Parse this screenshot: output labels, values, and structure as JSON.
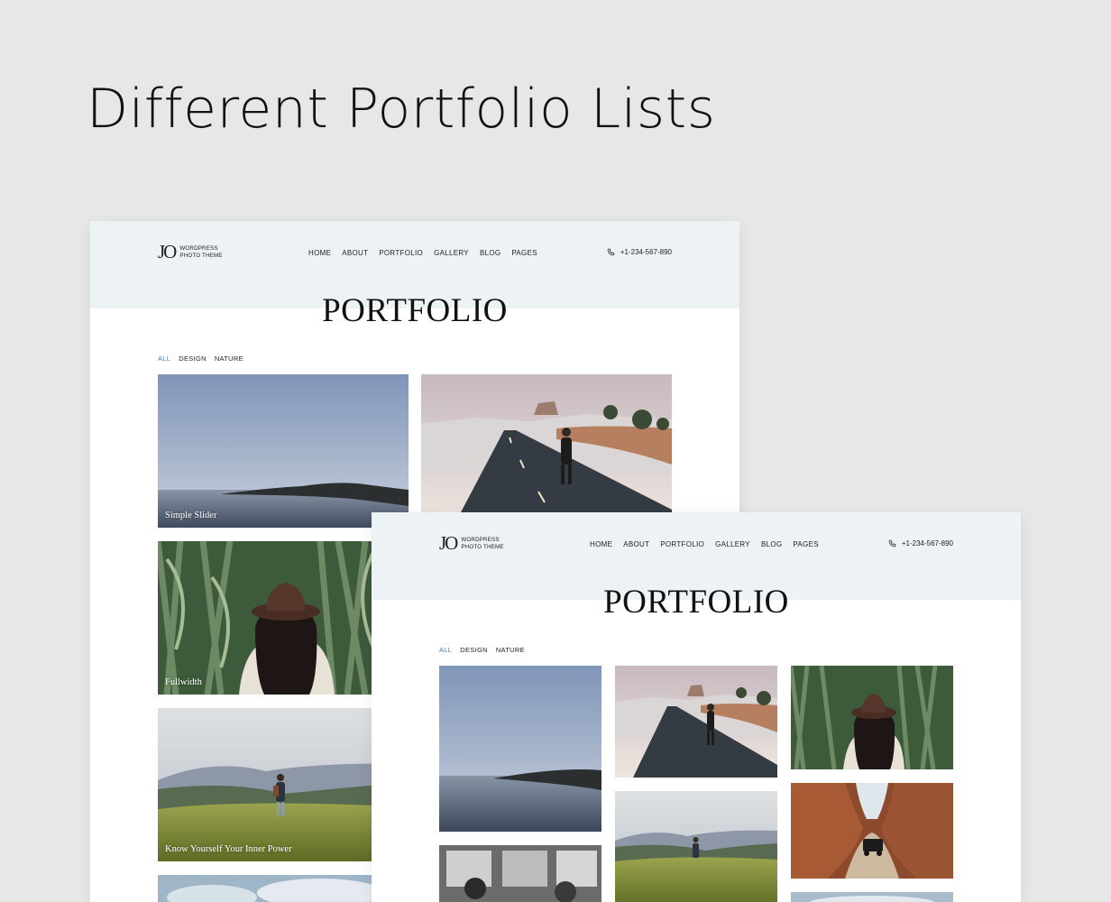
{
  "heading": "Different Portfolio Lists",
  "site": {
    "logo_mark": "JO",
    "logo_line1": "WORDPRESS",
    "logo_line2": "PHOTO THEME",
    "nav": [
      "HOME",
      "ABOUT",
      "PORTFOLIO",
      "GALLERY",
      "BLOG",
      "PAGES"
    ],
    "phone": "+1-234-567-890",
    "page_title": "PORTFOLIO",
    "filters": [
      "ALL",
      "DESIGN",
      "NATURE"
    ],
    "active_filter": "ALL",
    "accent_color": "#3d7bb8",
    "header_bg": "#edf2f4"
  },
  "list_two_column": {
    "captions": [
      "Simple Slider",
      "Fullwidth",
      "Know Yourself Your Inner Power"
    ]
  },
  "icons": {
    "phone": "phone-icon"
  }
}
